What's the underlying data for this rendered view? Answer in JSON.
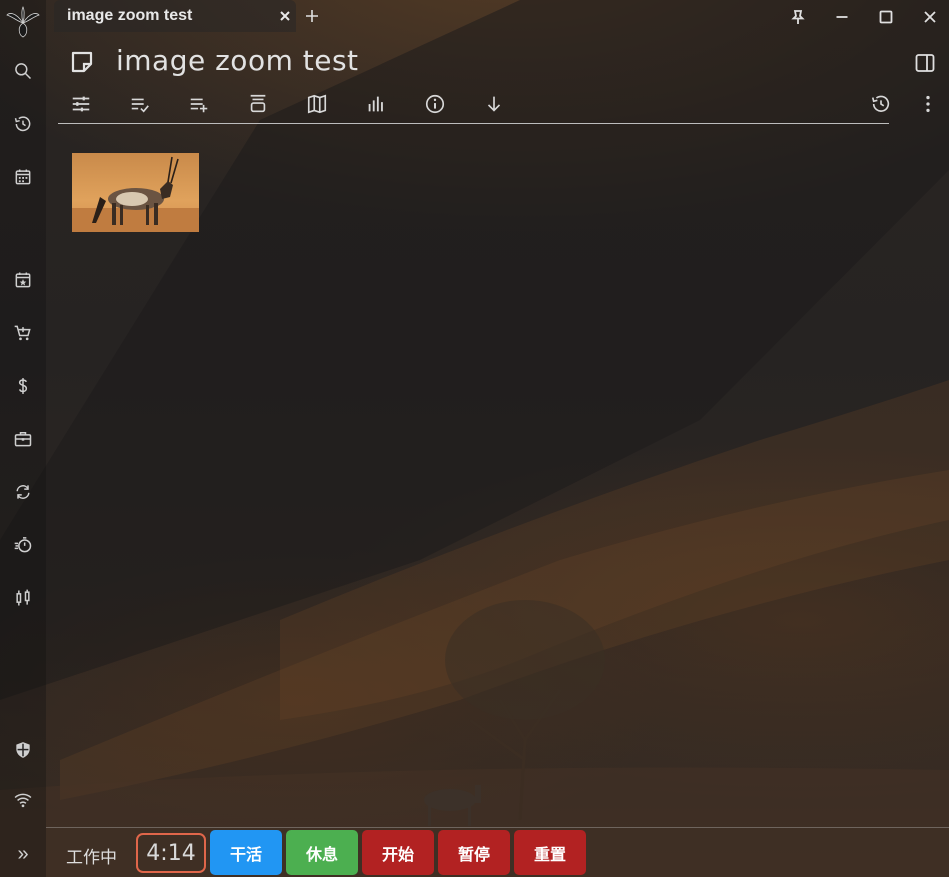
{
  "tab": {
    "title": "image zoom test",
    "close_glyph": "×",
    "new_glyph": "+"
  },
  "note": {
    "title": "image zoom test"
  },
  "sidebar": {
    "items": [
      {
        "icon": "search-icon"
      },
      {
        "icon": "history-icon"
      },
      {
        "icon": "calendar-icon"
      },
      {
        "icon": "calendar-star-icon"
      },
      {
        "icon": "cart-icon"
      },
      {
        "icon": "dollar-icon"
      },
      {
        "icon": "briefcase-icon"
      },
      {
        "icon": "sync-icon"
      },
      {
        "icon": "timer-icon"
      },
      {
        "icon": "candlestick-icon"
      },
      {
        "icon": "shield-icon"
      },
      {
        "icon": "wifi-icon"
      },
      {
        "icon": "expand-icon"
      }
    ],
    "expand_glyph": "»"
  },
  "toolbar": {
    "icons": [
      "properties-icon",
      "checklist-icon",
      "add-list-icon",
      "promoted-icon",
      "map-icon",
      "stats-icon",
      "info-icon",
      "download-icon",
      "revisions-icon",
      "more-icon"
    ]
  },
  "image": {
    "subject": "oryx-photo-icon"
  },
  "pomodoro": {
    "status": "工作中",
    "time": "4:14",
    "buttons": {
      "work": "干活",
      "rest": "休息",
      "start": "开始",
      "pause": "暂停",
      "reset": "重置"
    },
    "colors": {
      "work": "#2196f3",
      "rest": "#4caf50",
      "start": "#b22222",
      "pause": "#b22222",
      "reset": "#b22222",
      "timer_border": "#e0664a"
    }
  }
}
